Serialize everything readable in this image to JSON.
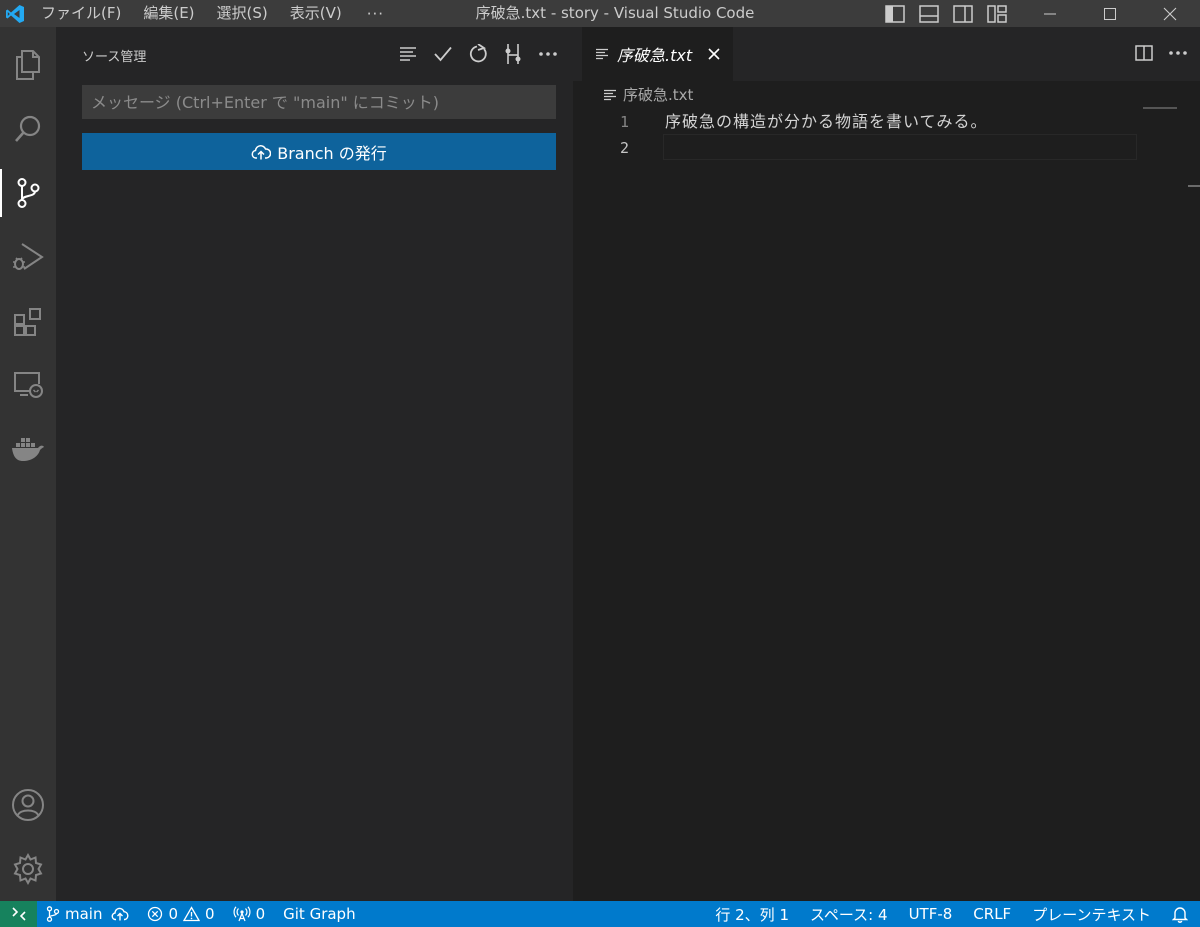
{
  "window": {
    "title": "序破急.txt - story - Visual Studio Code"
  },
  "menu": {
    "items": [
      "ファイル(F)",
      "編集(E)",
      "選択(S)",
      "表示(V)"
    ],
    "more": "···"
  },
  "sidebar": {
    "title": "ソース管理",
    "commit_placeholder": "メッセージ (Ctrl+Enter で \"main\" にコミット)",
    "publish_label": "Branch の発行"
  },
  "editor": {
    "tab_label": "序破急.txt",
    "breadcrumb": "序破急.txt",
    "lines": [
      {
        "num": "1",
        "text": "序破急の構造が分かる物語を書いてみる。"
      },
      {
        "num": "2",
        "text": ""
      }
    ]
  },
  "statusbar": {
    "branch": "main",
    "errors": "0",
    "warnings": "0",
    "ports": "0",
    "git_graph": "Git Graph",
    "position": "行 2、列 1",
    "spaces": "スペース: 4",
    "encoding": "UTF-8",
    "eol": "CRLF",
    "language": "プレーンテキスト"
  },
  "colors": {
    "accent": "#007acc",
    "button": "#0e639c",
    "remote": "#16825d"
  }
}
